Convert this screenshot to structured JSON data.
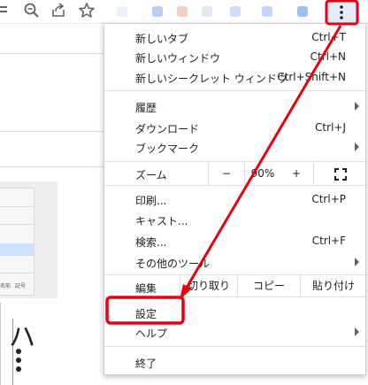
{
  "toolbar": {
    "icons": [
      "list-icon",
      "zoom-icon",
      "share-icon",
      "bookmark-star-icon",
      "more-menu-icon"
    ]
  },
  "menu": {
    "items_group1": [
      {
        "label": "新しいタブ",
        "shortcut": "Ctrl+T"
      },
      {
        "label": "新しいウィンドウ",
        "shortcut": "Ctrl+N"
      },
      {
        "label": "新しいシークレット ウィンドウ",
        "shortcut": "Ctrl+Shift+N"
      }
    ],
    "items_group2": [
      {
        "label": "履歴",
        "shortcut": ""
      },
      {
        "label": "ダウンロード",
        "shortcut": "Ctrl+J"
      },
      {
        "label": "ブックマーク",
        "shortcut": ""
      }
    ],
    "zoom": {
      "label": "ズーム",
      "minus": "−",
      "value": "90%",
      "plus": "+"
    },
    "items_group3": [
      {
        "label": "印刷...",
        "shortcut": "Ctrl+P"
      },
      {
        "label": "キャスト...",
        "shortcut": ""
      },
      {
        "label": "検索...",
        "shortcut": "Ctrl+F"
      },
      {
        "label": "その他のツール",
        "shortcut": ""
      }
    ],
    "edit": {
      "label": "編集",
      "cut": "切り取り",
      "copy": "コピー",
      "paste": "貼り付け"
    },
    "settings": {
      "label": "設定"
    },
    "help": {
      "label": "ヘルプ"
    },
    "exit": {
      "label": "終了"
    }
  },
  "background": {
    "dialog_footer": [
      "名前",
      "記号"
    ],
    "glyph": "ハ"
  },
  "colors": {
    "annotation": "#e60012",
    "kebab_highlight": "#e4edf8",
    "selection": "#cfe2fb"
  }
}
